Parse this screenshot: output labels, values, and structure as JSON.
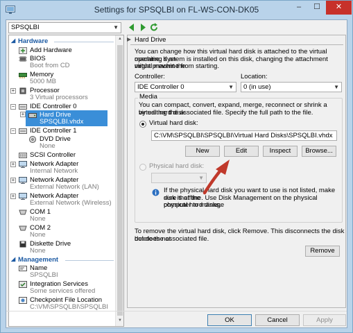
{
  "window": {
    "title": "Settings for SPSQLBI on FL-WS-CON-DK05",
    "controls": {
      "minimize": "–",
      "maximize": "☐",
      "close": "✕"
    }
  },
  "toolbar": {
    "vm_selector": "SPSQLBI"
  },
  "tree": {
    "hardware_header": "Hardware",
    "management_header": "Management",
    "add_hardware": {
      "name": "Add Hardware"
    },
    "bios": {
      "name": "BIOS",
      "sub": "Boot from CD"
    },
    "memory": {
      "name": "Memory",
      "sub": "5000 MB"
    },
    "processor": {
      "name": "Processor",
      "sub": "3 Virtual processors"
    },
    "ide0": {
      "name": "IDE Controller 0"
    },
    "hard_drive": {
      "name": "Hard Drive",
      "sub": "SPSQLBI.vhdx"
    },
    "ide1": {
      "name": "IDE Controller 1"
    },
    "dvd": {
      "name": "DVD Drive",
      "sub": "None"
    },
    "scsi": {
      "name": "SCSI Controller"
    },
    "nic1": {
      "name": "Network Adapter",
      "sub": "Internal Network"
    },
    "nic2": {
      "name": "Network Adapter",
      "sub": "External Network (LAN)"
    },
    "nic3": {
      "name": "Network Adapter",
      "sub": "External Network (Wireless)"
    },
    "com1": {
      "name": "COM 1",
      "sub": "None"
    },
    "com2": {
      "name": "COM 2",
      "sub": "None"
    },
    "diskette": {
      "name": "Diskette Drive",
      "sub": "None"
    },
    "name_item": {
      "name": "Name",
      "sub": "SPSQLBI"
    },
    "integration": {
      "name": "Integration Services",
      "sub": "Some services offered"
    },
    "checkpoint": {
      "name": "Checkpoint File Location",
      "sub": "C:\\VM\\SPSQLBI\\SPSQLBI"
    }
  },
  "pane": {
    "title": "Hard Drive",
    "intro": [
      "You can change how this virtual hard disk is attached to the virtual machine. If an",
      "operating system is installed on this disk, changing the attachment might prevent the",
      "virtual machine from starting."
    ],
    "controller_label": "Controller:",
    "controller_value": "IDE Controller 0",
    "location_label": "Location:",
    "location_value": "0 (in use)",
    "media_label": "Media",
    "media_desc": [
      "You can compact, convert, expand, merge, reconnect or shrink a virtual hard disk",
      "by editing the associated file. Specify the full path to the file."
    ],
    "vhd_radio_label": "Virtual hard disk:",
    "vhd_path": "C:\\VM\\SPSQLBI\\SPSQLBI\\Virtual Hard Disks\\SPSQLBI.vhdx",
    "buttons": {
      "new": "New",
      "edit": "Edit",
      "inspect": "Inspect",
      "browse": "Browse..."
    },
    "physical_radio_label": "Physical hard disk:",
    "physical_info": [
      "If the physical hard disk you want to use is not listed, make sure that the",
      "disk is offline. Use Disk Management on the physical computer to manage",
      "physical hard disks."
    ],
    "remove_desc": [
      "To remove the virtual hard disk, click Remove. This disconnects the disk but does not",
      "delete the associated file."
    ],
    "remove_button": "Remove"
  },
  "footer": {
    "ok": "OK",
    "cancel": "Cancel",
    "apply": "Apply"
  },
  "colors": {
    "selection": "#3a8ed8",
    "annotation_arrow": "#c0392b",
    "section_header": "#1c5aa3"
  }
}
